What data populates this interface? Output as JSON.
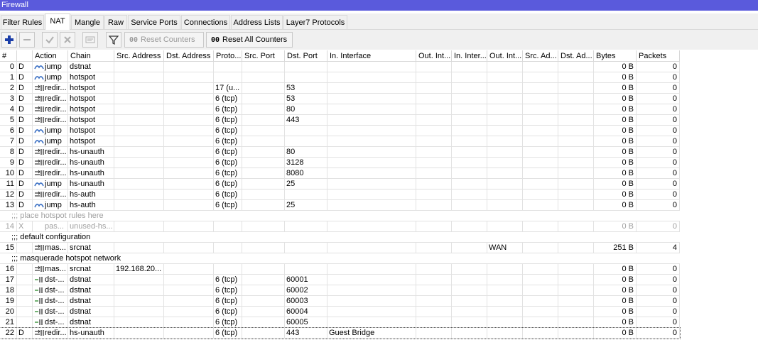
{
  "window": {
    "title": "Firewall"
  },
  "tabs": [
    {
      "label": "Filter Rules"
    },
    {
      "label": "NAT"
    },
    {
      "label": "Mangle"
    },
    {
      "label": "Raw"
    },
    {
      "label": "Service Ports"
    },
    {
      "label": "Connections"
    },
    {
      "label": "Address Lists"
    },
    {
      "label": "Layer7 Protocols"
    }
  ],
  "active_tab": "NAT",
  "toolbar": {
    "add_icon": "plus-icon",
    "remove_icon": "minus-icon",
    "enable_icon": "check-icon",
    "disable_icon": "x-icon",
    "comment_icon": "comment-icon",
    "filter_icon": "filter-icon",
    "reset_counters": "Reset Counters",
    "reset_all_counters": "Reset All Counters",
    "oo": "00"
  },
  "columns": [
    "#",
    "",
    "Action",
    "Chain",
    "Src. Address",
    "Dst. Address",
    "Proto...",
    "Src. Port",
    "Dst. Port",
    "In. Interface",
    "Out. Int...",
    "In. Inter...",
    "Out. Int...",
    "Src. Ad...",
    "Dst. Ad...",
    "Bytes",
    "Packets"
  ],
  "rows": [
    {
      "type": "rule",
      "num": "0",
      "flag": "D",
      "action": "jump",
      "chain": "dstnat",
      "src": "",
      "dst": "",
      "proto": "",
      "sport": "",
      "dport": "",
      "inif": "",
      "outif": "",
      "outlist": "",
      "bytes": "0 B",
      "packets": "0"
    },
    {
      "type": "rule",
      "num": "1",
      "flag": "D",
      "action": "jump",
      "chain": "hotspot",
      "src": "",
      "dst": "",
      "proto": "",
      "sport": "",
      "dport": "",
      "inif": "",
      "outif": "",
      "outlist": "",
      "bytes": "0 B",
      "packets": "0"
    },
    {
      "type": "rule",
      "num": "2",
      "flag": "D",
      "action": "redir...",
      "chain": "hotspot",
      "src": "",
      "dst": "",
      "proto": "17 (u...",
      "sport": "",
      "dport": "53",
      "inif": "",
      "outif": "",
      "outlist": "",
      "bytes": "0 B",
      "packets": "0"
    },
    {
      "type": "rule",
      "num": "3",
      "flag": "D",
      "action": "redir...",
      "chain": "hotspot",
      "src": "",
      "dst": "",
      "proto": "6 (tcp)",
      "sport": "",
      "dport": "53",
      "inif": "",
      "outif": "",
      "outlist": "",
      "bytes": "0 B",
      "packets": "0"
    },
    {
      "type": "rule",
      "num": "4",
      "flag": "D",
      "action": "redir...",
      "chain": "hotspot",
      "src": "",
      "dst": "",
      "proto": "6 (tcp)",
      "sport": "",
      "dport": "80",
      "inif": "",
      "outif": "",
      "outlist": "",
      "bytes": "0 B",
      "packets": "0"
    },
    {
      "type": "rule",
      "num": "5",
      "flag": "D",
      "action": "redir...",
      "chain": "hotspot",
      "src": "",
      "dst": "",
      "proto": "6 (tcp)",
      "sport": "",
      "dport": "443",
      "inif": "",
      "outif": "",
      "outlist": "",
      "bytes": "0 B",
      "packets": "0"
    },
    {
      "type": "rule",
      "num": "6",
      "flag": "D",
      "action": "jump",
      "chain": "hotspot",
      "src": "",
      "dst": "",
      "proto": "6 (tcp)",
      "sport": "",
      "dport": "",
      "inif": "",
      "outif": "",
      "outlist": "",
      "bytes": "0 B",
      "packets": "0"
    },
    {
      "type": "rule",
      "num": "7",
      "flag": "D",
      "action": "jump",
      "chain": "hotspot",
      "src": "",
      "dst": "",
      "proto": "6 (tcp)",
      "sport": "",
      "dport": "",
      "inif": "",
      "outif": "",
      "outlist": "",
      "bytes": "0 B",
      "packets": "0"
    },
    {
      "type": "rule",
      "num": "8",
      "flag": "D",
      "action": "redir...",
      "chain": "hs-unauth",
      "src": "",
      "dst": "",
      "proto": "6 (tcp)",
      "sport": "",
      "dport": "80",
      "inif": "",
      "outif": "",
      "outlist": "",
      "bytes": "0 B",
      "packets": "0"
    },
    {
      "type": "rule",
      "num": "9",
      "flag": "D",
      "action": "redir...",
      "chain": "hs-unauth",
      "src": "",
      "dst": "",
      "proto": "6 (tcp)",
      "sport": "",
      "dport": "3128",
      "inif": "",
      "outif": "",
      "outlist": "",
      "bytes": "0 B",
      "packets": "0"
    },
    {
      "type": "rule",
      "num": "10",
      "flag": "D",
      "action": "redir...",
      "chain": "hs-unauth",
      "src": "",
      "dst": "",
      "proto": "6 (tcp)",
      "sport": "",
      "dport": "8080",
      "inif": "",
      "outif": "",
      "outlist": "",
      "bytes": "0 B",
      "packets": "0"
    },
    {
      "type": "rule",
      "num": "11",
      "flag": "D",
      "action": "jump",
      "chain": "hs-unauth",
      "src": "",
      "dst": "",
      "proto": "6 (tcp)",
      "sport": "",
      "dport": "25",
      "inif": "",
      "outif": "",
      "outlist": "",
      "bytes": "0 B",
      "packets": "0"
    },
    {
      "type": "rule",
      "num": "12",
      "flag": "D",
      "action": "redir...",
      "chain": "hs-auth",
      "src": "",
      "dst": "",
      "proto": "6 (tcp)",
      "sport": "",
      "dport": "",
      "inif": "",
      "outif": "",
      "outlist": "",
      "bytes": "0 B",
      "packets": "0"
    },
    {
      "type": "rule",
      "num": "13",
      "flag": "D",
      "action": "jump",
      "chain": "hs-auth",
      "src": "",
      "dst": "",
      "proto": "6 (tcp)",
      "sport": "",
      "dport": "25",
      "inif": "",
      "outif": "",
      "outlist": "",
      "bytes": "0 B",
      "packets": "0"
    },
    {
      "type": "comment",
      "text": ";;; place hotspot rules here",
      "disabled": true
    },
    {
      "type": "rule",
      "num": "14",
      "flag": "X",
      "action": "pas...",
      "chain": "unused-hs...",
      "src": "",
      "dst": "",
      "proto": "",
      "sport": "",
      "dport": "",
      "inif": "",
      "outif": "",
      "outlist": "",
      "bytes": "0 B",
      "packets": "0",
      "disabled": true
    },
    {
      "type": "comment",
      "text": ";;; default configuration"
    },
    {
      "type": "rule",
      "num": "15",
      "flag": "",
      "action": "mas...",
      "chain": "srcnat",
      "src": "",
      "dst": "",
      "proto": "",
      "sport": "",
      "dport": "",
      "inif": "",
      "outif": "",
      "outlist": "WAN",
      "bytes": "251 B",
      "packets": "4"
    },
    {
      "type": "comment",
      "text": ";;; masquerade hotspot network"
    },
    {
      "type": "rule",
      "num": "16",
      "flag": "",
      "action": "mas...",
      "chain": "srcnat",
      "src": "192.168.20...",
      "dst": "",
      "proto": "",
      "sport": "",
      "dport": "",
      "inif": "",
      "outif": "",
      "outlist": "",
      "bytes": "0 B",
      "packets": "0"
    },
    {
      "type": "rule",
      "num": "17",
      "flag": "",
      "action": "dst-...",
      "chain": "dstnat",
      "src": "",
      "dst": "",
      "proto": "6 (tcp)",
      "sport": "",
      "dport": "60001",
      "inif": "",
      "outif": "",
      "outlist": "",
      "bytes": "0 B",
      "packets": "0"
    },
    {
      "type": "rule",
      "num": "18",
      "flag": "",
      "action": "dst-...",
      "chain": "dstnat",
      "src": "",
      "dst": "",
      "proto": "6 (tcp)",
      "sport": "",
      "dport": "60002",
      "inif": "",
      "outif": "",
      "outlist": "",
      "bytes": "0 B",
      "packets": "0"
    },
    {
      "type": "rule",
      "num": "19",
      "flag": "",
      "action": "dst-...",
      "chain": "dstnat",
      "src": "",
      "dst": "",
      "proto": "6 (tcp)",
      "sport": "",
      "dport": "60003",
      "inif": "",
      "outif": "",
      "outlist": "",
      "bytes": "0 B",
      "packets": "0"
    },
    {
      "type": "rule",
      "num": "20",
      "flag": "",
      "action": "dst-...",
      "chain": "dstnat",
      "src": "",
      "dst": "",
      "proto": "6 (tcp)",
      "sport": "",
      "dport": "60004",
      "inif": "",
      "outif": "",
      "outlist": "",
      "bytes": "0 B",
      "packets": "0"
    },
    {
      "type": "rule",
      "num": "21",
      "flag": "",
      "action": "dst-...",
      "chain": "dstnat",
      "src": "",
      "dst": "",
      "proto": "6 (tcp)",
      "sport": "",
      "dport": "60005",
      "inif": "",
      "outif": "",
      "outlist": "",
      "bytes": "0 B",
      "packets": "0"
    },
    {
      "type": "rule",
      "num": "22",
      "flag": "D",
      "action": "redir...",
      "chain": "hs-unauth",
      "src": "",
      "dst": "",
      "proto": "6 (tcp)",
      "sport": "",
      "dport": "443",
      "inif": "Guest Bridge",
      "outif": "",
      "outlist": "",
      "bytes": "0 B",
      "packets": "0",
      "selected": true
    }
  ],
  "colors": {
    "titlebar": "#5a5adc",
    "disabled_text": "#a0a0a0",
    "jump_icon": "#3a6fc4"
  }
}
